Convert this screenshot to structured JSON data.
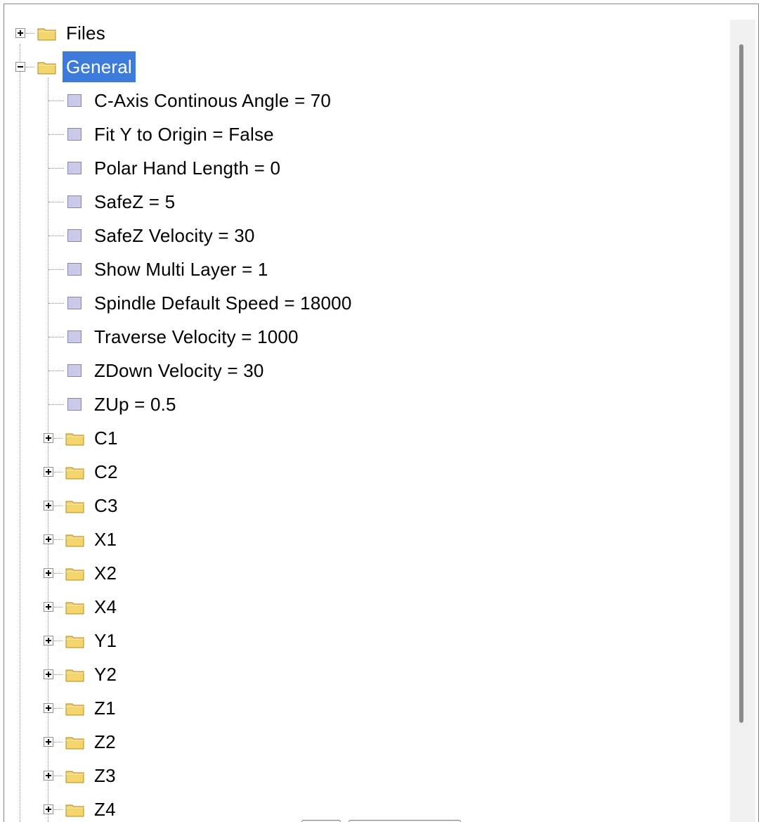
{
  "tree": {
    "root_items": [
      {
        "label": "Files",
        "icon": "folder-icon",
        "expanded": false
      },
      {
        "label": "General",
        "icon": "folder-icon",
        "expanded": true,
        "selected": true
      }
    ],
    "general_children": [
      {
        "label": "C-Axis Continous Angle = 70",
        "icon": "setting-icon"
      },
      {
        "label": "Fit Y to Origin = False",
        "icon": "setting-icon"
      },
      {
        "label": "Polar Hand Length = 0",
        "icon": "setting-icon"
      },
      {
        "label": "SafeZ = 5",
        "icon": "setting-icon"
      },
      {
        "label": "SafeZ Velocity = 30",
        "icon": "setting-icon"
      },
      {
        "label": "Show Multi Layer = 1",
        "icon": "setting-icon"
      },
      {
        "label": "Spindle Default Speed = 18000",
        "icon": "setting-icon"
      },
      {
        "label": "Traverse Velocity = 1000",
        "icon": "setting-icon"
      },
      {
        "label": "ZDown Velocity = 30",
        "icon": "setting-icon"
      },
      {
        "label": "ZUp = 0.5",
        "icon": "setting-icon"
      }
    ],
    "general_folders": [
      {
        "label": "C1",
        "icon": "folder-icon",
        "expanded": false
      },
      {
        "label": "C2",
        "icon": "folder-icon",
        "expanded": false
      },
      {
        "label": "C3",
        "icon": "folder-icon",
        "expanded": false
      },
      {
        "label": "X1",
        "icon": "folder-icon",
        "expanded": false
      },
      {
        "label": "X2",
        "icon": "folder-icon",
        "expanded": false
      },
      {
        "label": "X4",
        "icon": "folder-icon",
        "expanded": false
      },
      {
        "label": "Y1",
        "icon": "folder-icon",
        "expanded": false
      },
      {
        "label": "Y2",
        "icon": "folder-icon",
        "expanded": false
      },
      {
        "label": "Z1",
        "icon": "folder-icon",
        "expanded": false
      },
      {
        "label": "Z2",
        "icon": "folder-icon",
        "expanded": false
      },
      {
        "label": "Z3",
        "icon": "folder-icon",
        "expanded": false
      },
      {
        "label": "Z4",
        "icon": "folder-icon",
        "expanded": false
      }
    ]
  },
  "colors": {
    "selection": "#3d7bdb",
    "folder": "#f4d46c",
    "setting_icon": "#c9c9e9"
  }
}
